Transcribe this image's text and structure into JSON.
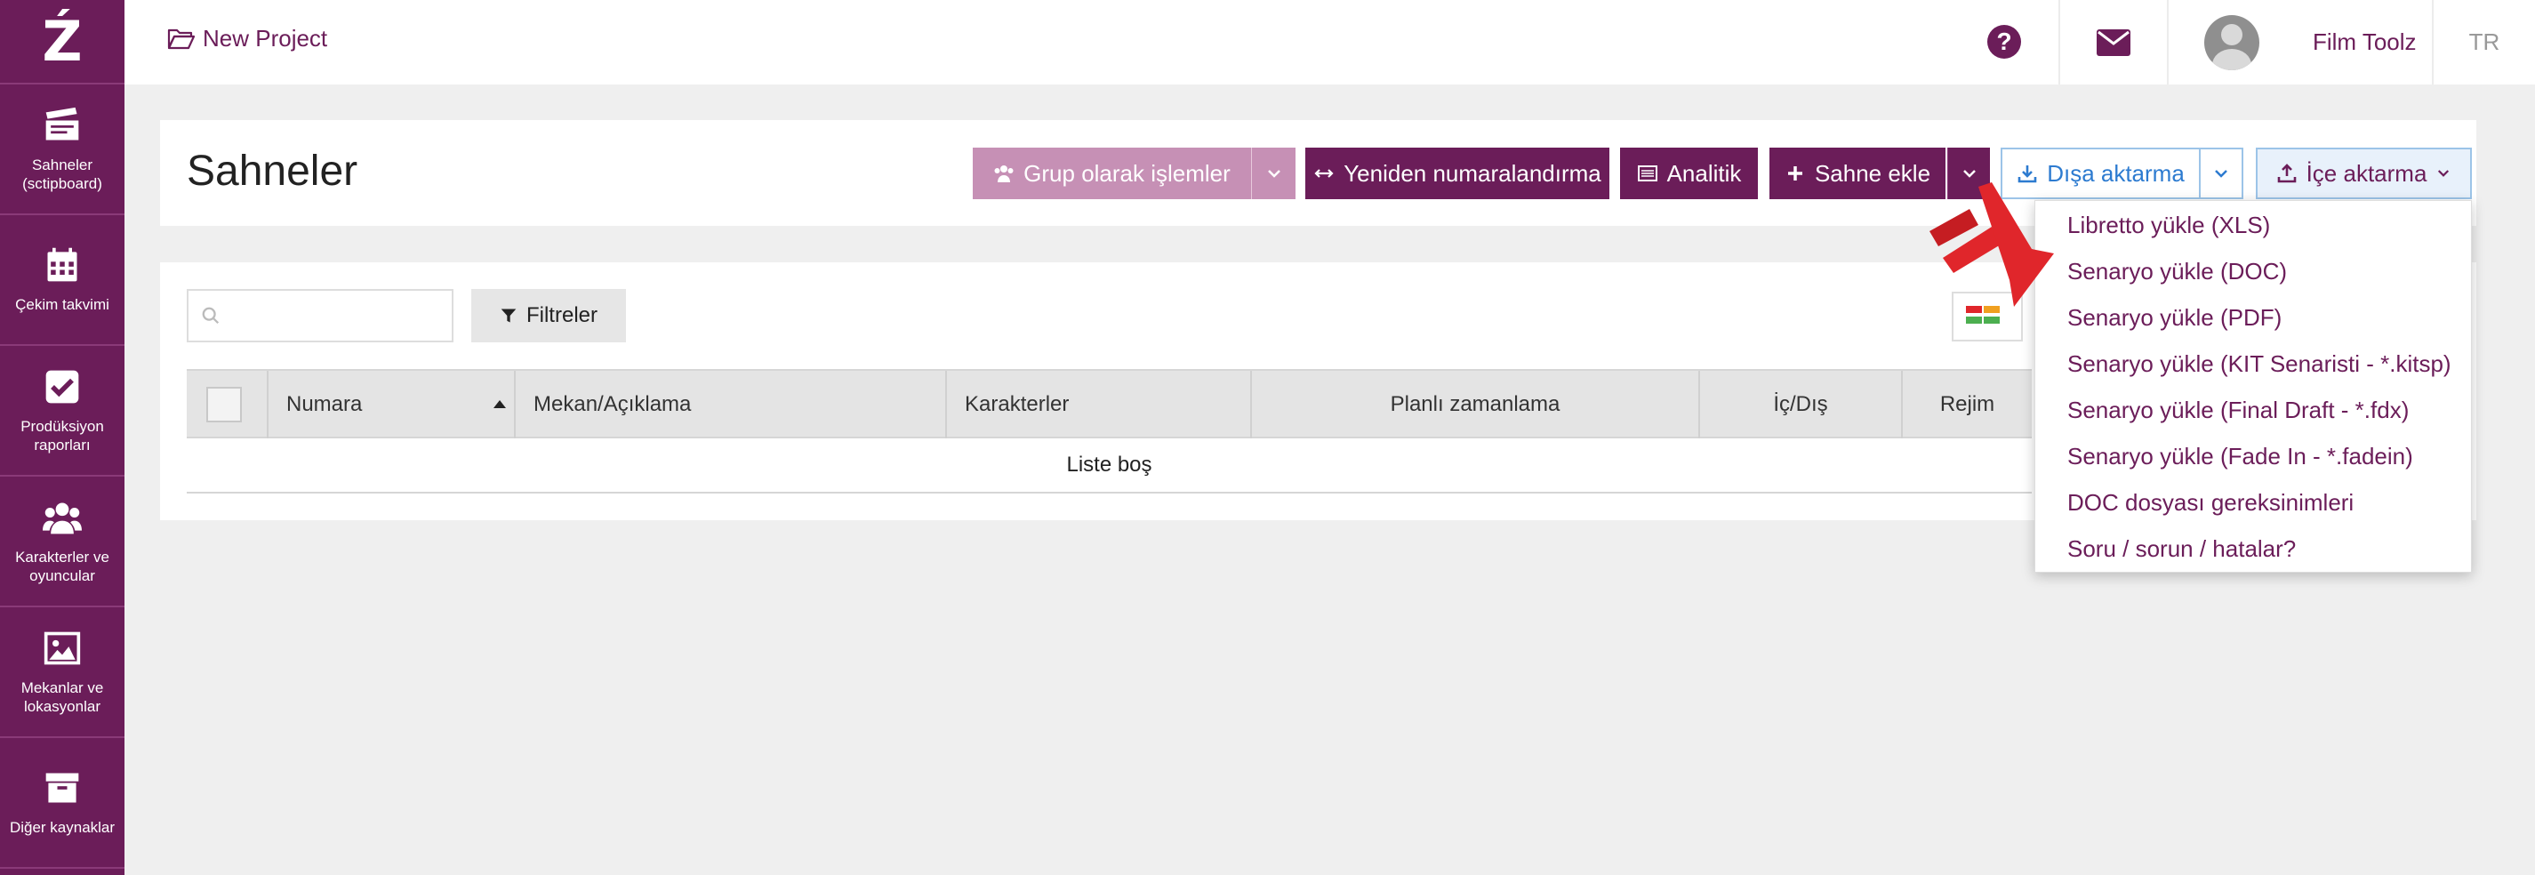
{
  "sidebar": {
    "logo": "Ź",
    "items": [
      {
        "label": "Sahneler (sctipboard)",
        "icon": "clapperboard-icon"
      },
      {
        "label": "Çekim takvimi",
        "icon": "calendar-icon"
      },
      {
        "label": "Prodüksiyon raporları",
        "icon": "checkbox-icon"
      },
      {
        "label": "Karakterler ve oyuncular",
        "icon": "users-icon"
      },
      {
        "label": "Mekanlar ve lokasyonlar",
        "icon": "image-icon"
      },
      {
        "label": "Diğer kaynaklar",
        "icon": "archive-icon"
      }
    ]
  },
  "topbar": {
    "project_label": "New Project",
    "project_icon": "folder-open-icon",
    "help_icon": "question-circle-icon",
    "mail_icon": "envelope-icon",
    "user_name": "Film Toolz",
    "language": "TR"
  },
  "page": {
    "title": "Sahneler",
    "buttons": {
      "group_ops": "Grup olarak işlemler",
      "renumber": "Yeniden numaralandırma",
      "analytics": "Analitik",
      "add_scene": "Sahne ekle",
      "export": "Dışa aktarma",
      "import": "İçe aktarma"
    }
  },
  "toolbar": {
    "search_placeholder": "",
    "filters_label": "Filtreler"
  },
  "table": {
    "columns": [
      "Numara",
      "Mekan/Açıklama",
      "Karakterler",
      "Planlı zamanlama",
      "İç/Dış",
      "Rejim"
    ],
    "empty_message": "Liste boş"
  },
  "import_menu": {
    "items": [
      "Libretto yükle (XLS)",
      "Senaryo yükle (DOC)",
      "Senaryo yükle (PDF)",
      "Senaryo yükle (KIT Senaristi - *.kitsp)",
      "Senaryo yükle (Final Draft - *.fdx)",
      "Senaryo yükle (Fade In - *.fadein)",
      "DOC dosyası gereksinimleri",
      "Soru / sorun / hatalar?"
    ]
  },
  "colors": {
    "brand": "#6b1d59",
    "brand_light": "#c690b5",
    "link_blue": "#2d7bd0",
    "arrow_red": "#e0262b"
  }
}
